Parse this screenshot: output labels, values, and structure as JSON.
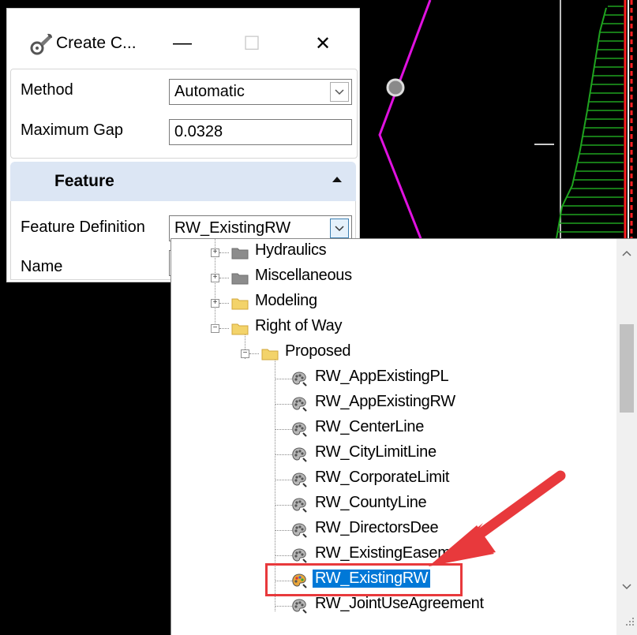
{
  "dialog": {
    "title": "Create C...",
    "minimize_glyph": "—",
    "maximize_glyph": "☐",
    "close_glyph": "✕",
    "method_label": "Method",
    "method_value": "Automatic",
    "max_gap_label": "Maximum Gap",
    "max_gap_value": "0.0328",
    "feature_section_title": "Feature",
    "feature_def_label": "Feature Definition",
    "feature_def_value": "RW_ExistingRW",
    "name_label": "Name"
  },
  "tree": {
    "items": [
      {
        "label": "Hydraulics",
        "type": "folder-gray",
        "expander": "+"
      },
      {
        "label": "Miscellaneous",
        "type": "folder-gray",
        "expander": "+"
      },
      {
        "label": "Modeling",
        "type": "folder-yellow",
        "expander": "+"
      },
      {
        "label": "Right of Way",
        "type": "folder-yellow",
        "expander": "−"
      },
      {
        "label": "Proposed",
        "type": "folder-yellow",
        "expander": "−"
      },
      {
        "label": "RW_AppExistingPL",
        "type": "feature"
      },
      {
        "label": "RW_AppExistingRW",
        "type": "feature"
      },
      {
        "label": "RW_CenterLine",
        "type": "feature"
      },
      {
        "label": "RW_CityLimitLine",
        "type": "feature"
      },
      {
        "label": "RW_CorporateLimit",
        "type": "feature"
      },
      {
        "label": "RW_CountyLine",
        "type": "feature"
      },
      {
        "label": "RW_DirectorsDee",
        "type": "feature"
      },
      {
        "label": "RW_ExistingEasement",
        "type": "feature"
      },
      {
        "label": "RW_ExistingRW",
        "type": "feature",
        "selected": true
      },
      {
        "label": "RW_JointUseAgreement",
        "type": "feature"
      }
    ]
  },
  "colors": {
    "selection": "#0078d7",
    "callout": "#e8393c",
    "cad_magenta": "#e011e0",
    "cad_green": "#1fa31f",
    "cad_red": "#ff2020"
  }
}
